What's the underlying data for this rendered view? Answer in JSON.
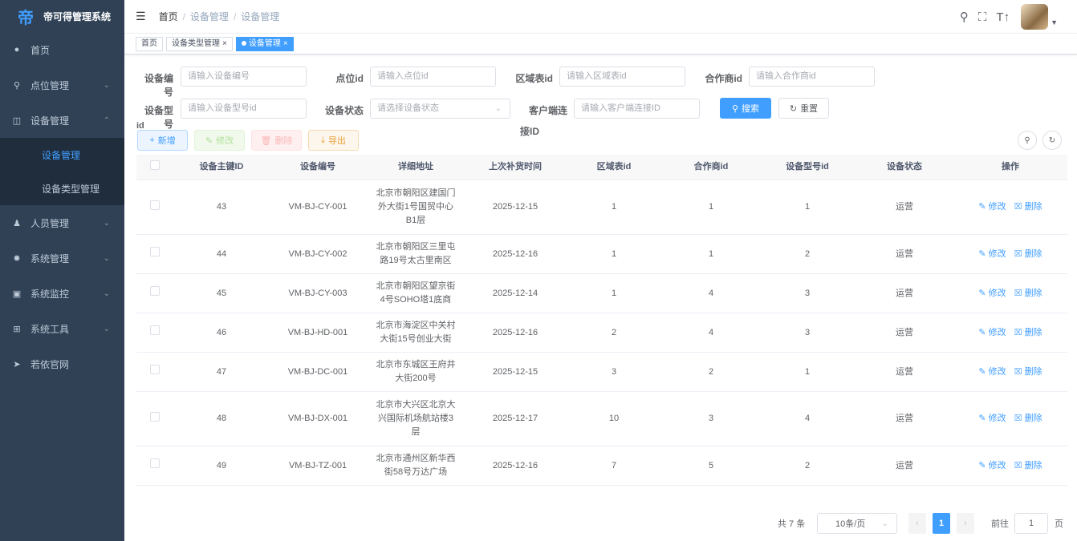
{
  "app": {
    "title": "帝可得管理系统",
    "logo_char": "帝"
  },
  "sidebar": {
    "items": [
      {
        "label": "首页",
        "icon": "dashboard-icon"
      },
      {
        "label": "点位管理",
        "icon": "location-icon"
      },
      {
        "label": "设备管理",
        "icon": "device-icon"
      },
      {
        "label": "人员管理",
        "icon": "user-icon"
      },
      {
        "label": "系统管理",
        "icon": "gear-icon"
      },
      {
        "label": "系统监控",
        "icon": "monitor-icon"
      },
      {
        "label": "系统工具",
        "icon": "tool-icon"
      },
      {
        "label": "若依官网",
        "icon": "send-icon"
      }
    ],
    "sub_items": [
      {
        "label": "设备管理",
        "active": true
      },
      {
        "label": "设备类型管理",
        "active": false
      }
    ]
  },
  "breadcrumb": {
    "home": "首页",
    "level1": "设备管理",
    "level2": "设备管理",
    "sep": "/"
  },
  "tags": [
    {
      "label": "首页"
    },
    {
      "label": "设备类型管理",
      "close": "×"
    },
    {
      "label": "设备管理",
      "close": "×"
    }
  ],
  "search": {
    "device_no": {
      "label": "设备编号",
      "placeholder": "请输入设备编号"
    },
    "point_id": {
      "label": "点位id",
      "placeholder": "请输入点位id"
    },
    "region_id": {
      "label": "区域表id",
      "placeholder": "请输入区域表id"
    },
    "partner_id": {
      "label": "合作商id",
      "placeholder": "请输入合作商id"
    },
    "model_id": {
      "label": "设备型号",
      "label2": "id",
      "placeholder": "请输入设备型号id"
    },
    "status": {
      "label": "设备状态",
      "placeholder": "请选择设备状态"
    },
    "client_id": {
      "label": "客户端连",
      "label2": "接ID",
      "placeholder": "请输入客户端连接ID"
    },
    "search_btn": "搜索",
    "reset_btn": "重置"
  },
  "toolbar": {
    "add": "新增",
    "edit": "修改",
    "delete": "删除",
    "export": "导出"
  },
  "table": {
    "headers": [
      "设备主键ID",
      "设备编号",
      "详细地址",
      "上次补货时间",
      "区域表id",
      "合作商id",
      "设备型号id",
      "设备状态",
      "操作"
    ],
    "rows": [
      {
        "id": "43",
        "no": "VM-BJ-CY-001",
        "addr": [
          "北京市朝阳区建国门",
          "外大街1号国贸中心",
          "B1层"
        ],
        "time": "2025-12-15",
        "region": "1",
        "partner": "1",
        "model": "1",
        "status": "运营"
      },
      {
        "id": "44",
        "no": "VM-BJ-CY-002",
        "addr": [
          "北京市朝阳区三里屯",
          "路19号太古里南区"
        ],
        "time": "2025-12-16",
        "region": "1",
        "partner": "1",
        "model": "2",
        "status": "运营"
      },
      {
        "id": "45",
        "no": "VM-BJ-CY-003",
        "addr": [
          "北京市朝阳区望京街",
          "4号SOHO塔1底商"
        ],
        "time": "2025-12-14",
        "region": "1",
        "partner": "4",
        "model": "3",
        "status": "运营"
      },
      {
        "id": "46",
        "no": "VM-BJ-HD-001",
        "addr": [
          "北京市海淀区中关村",
          "大街15号创业大街"
        ],
        "time": "2025-12-16",
        "region": "2",
        "partner": "4",
        "model": "3",
        "status": "运营"
      },
      {
        "id": "47",
        "no": "VM-BJ-DC-001",
        "addr": [
          "北京市东城区王府井",
          "大街200号"
        ],
        "time": "2025-12-15",
        "region": "3",
        "partner": "2",
        "model": "1",
        "status": "运营"
      },
      {
        "id": "48",
        "no": "VM-BJ-DX-001",
        "addr": [
          "北京市大兴区北京大",
          "兴国际机场航站楼3",
          "层"
        ],
        "time": "2025-12-17",
        "region": "10",
        "partner": "3",
        "model": "4",
        "status": "运营"
      },
      {
        "id": "49",
        "no": "VM-BJ-TZ-001",
        "addr": [
          "北京市通州区新华西",
          "街58号万达广场"
        ],
        "time": "2025-12-16",
        "region": "7",
        "partner": "5",
        "model": "2",
        "status": "运营"
      }
    ],
    "op_edit": "修改",
    "op_delete": "删除"
  },
  "pagination": {
    "total": "共 7 条",
    "page_size": "10条/页",
    "current": "1",
    "goto_prefix": "前往",
    "goto_value": "1",
    "goto_suffix": "页"
  }
}
